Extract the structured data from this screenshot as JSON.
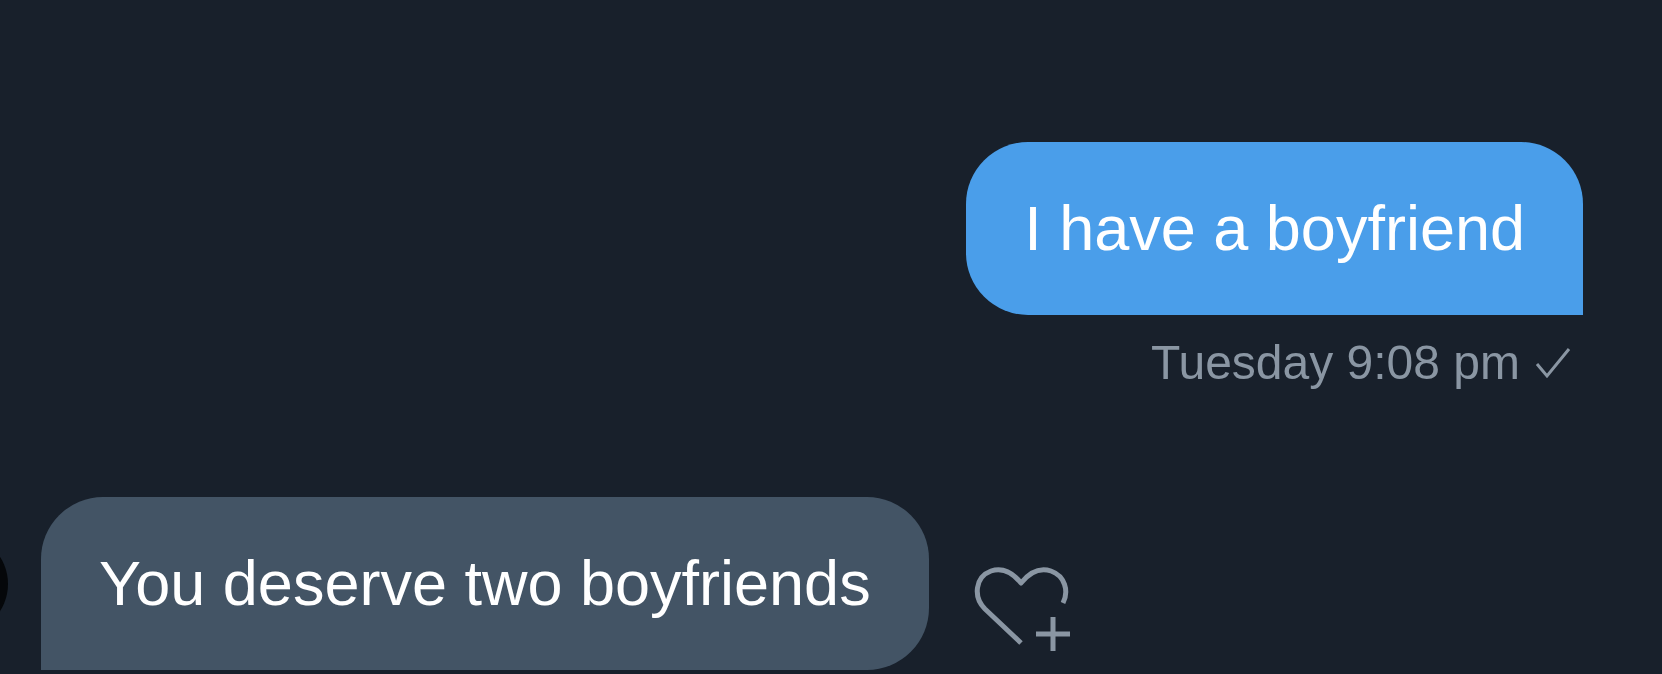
{
  "messages": [
    {
      "kind": "sent",
      "text": "I have a boyfriend",
      "meta": "Tuesday 9:08 pm",
      "read": true
    },
    {
      "kind": "received",
      "text": "You deserve two boyfriends",
      "avatar": true,
      "liked": false
    }
  ]
}
